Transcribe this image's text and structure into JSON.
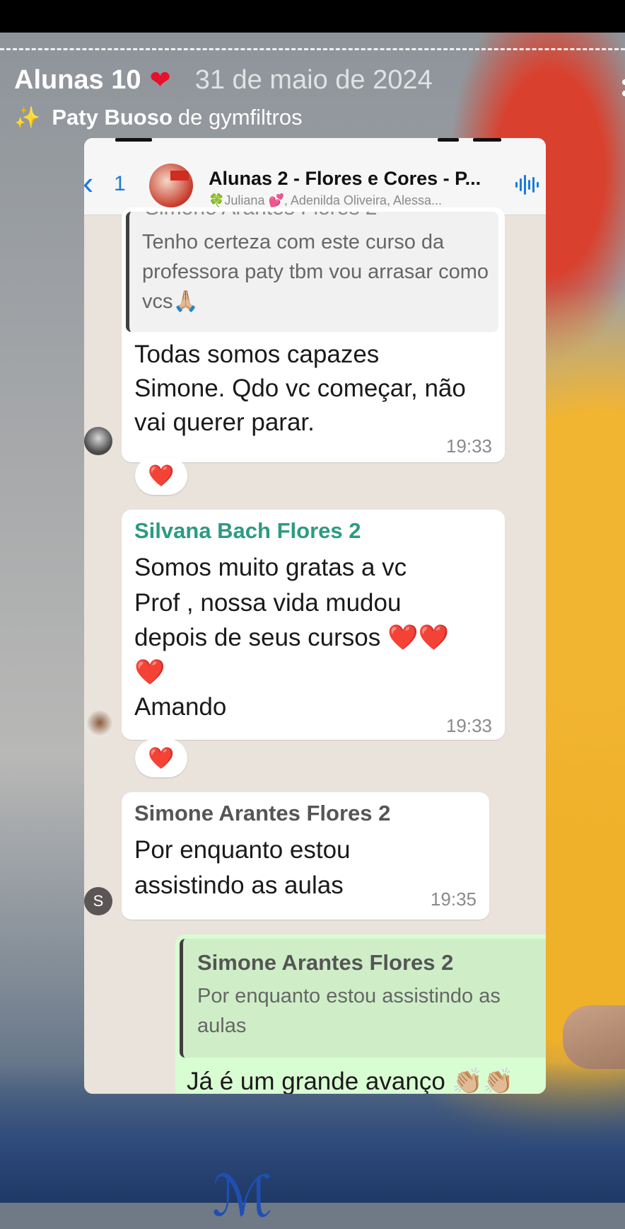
{
  "story": {
    "title": "Alunas 10",
    "title_heart": "❤",
    "date": "31 de maio de 2024",
    "credit_icon": "✨",
    "credit_name": "Paty Buoso",
    "credit_rest": "de gymfiltros"
  },
  "chat_header": {
    "back_icon": "chevron-left-icon",
    "back_glyph": "‹",
    "back_count": "1",
    "group_name": "Alunas 2 - Flores e Cores - P...",
    "members": "🍀Juliana 💕, Adenilda Oliveira, Alessa..."
  },
  "messages": [
    {
      "id": "m1",
      "cut_sender": "Simone Arantes Flores 2",
      "quote_text": "Tenho certeza com este curso da professora paty tbm vou arrasar como vcs🙏🏼",
      "text": "Todas somos capazes Simone.  Qdo vc começar, não vai querer parar.",
      "time": "19:33",
      "reaction": "❤️"
    },
    {
      "id": "m2",
      "sender": "Silvana Bach Flores 2",
      "sender_color": "#2d9a83",
      "text_lines": [
        "Somos muito gratas a vc",
        "Prof , nossa vida mudou",
        "depois de seus cursos ❤️❤️",
        "❤️",
        "Amando"
      ],
      "time": "19:33",
      "reaction": "❤️"
    },
    {
      "id": "m3",
      "sender": "Simone Arantes Flores 2",
      "sender_color": "#555555",
      "avatar_letter": "S",
      "text_lines": [
        "Por enquanto estou",
        "assistindo as aulas"
      ],
      "time": "19:35"
    },
    {
      "id": "m4",
      "quote_sender": "Simone Arantes Flores 2",
      "quote_text": "Por enquanto estou assistindo as aulas",
      "text": "Já é um grande avanço 👏🏼👏🏼"
    }
  ],
  "colors": {
    "ios_blue": "#1a7ae0",
    "outgoing_bubble": "#d9fdd3",
    "chat_bg": "#e9e3dc"
  }
}
